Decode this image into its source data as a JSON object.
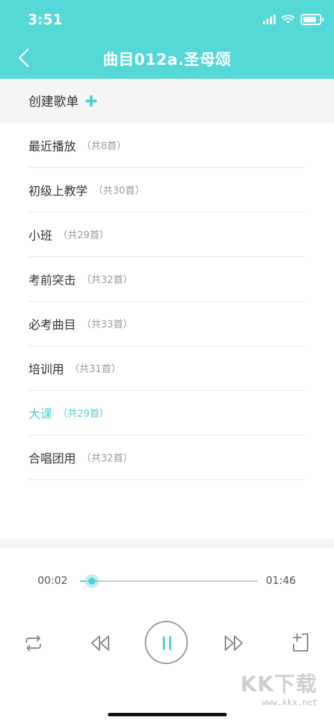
{
  "status_bar": {
    "time": "3:51"
  },
  "nav": {
    "title": "曲目012a.圣母颂"
  },
  "create": {
    "label": "创建歌单"
  },
  "playlists": [
    {
      "name": "最近播放",
      "count": "（共8首）",
      "active": false
    },
    {
      "name": "初级上教学",
      "count": "（共30首）",
      "active": false
    },
    {
      "name": "小班",
      "count": "（共29首）",
      "active": false
    },
    {
      "name": "考前突击",
      "count": "（共32首）",
      "active": false
    },
    {
      "name": "必考曲目",
      "count": "（共33首）",
      "active": false
    },
    {
      "name": "培训用",
      "count": "（共31首）",
      "active": false
    },
    {
      "name": "大课",
      "count": "（共29首）",
      "active": true
    },
    {
      "name": "合唱团用",
      "count": "（共32首）",
      "active": false
    }
  ],
  "player": {
    "current_time": "00:02",
    "total_time": "01:46",
    "progress": 0.03,
    "state": "playing"
  },
  "colors": {
    "accent": "#4FCFD3",
    "header": "#54D8D8"
  },
  "watermark": {
    "logo": "KK下载",
    "url": "www.kkx.net"
  }
}
